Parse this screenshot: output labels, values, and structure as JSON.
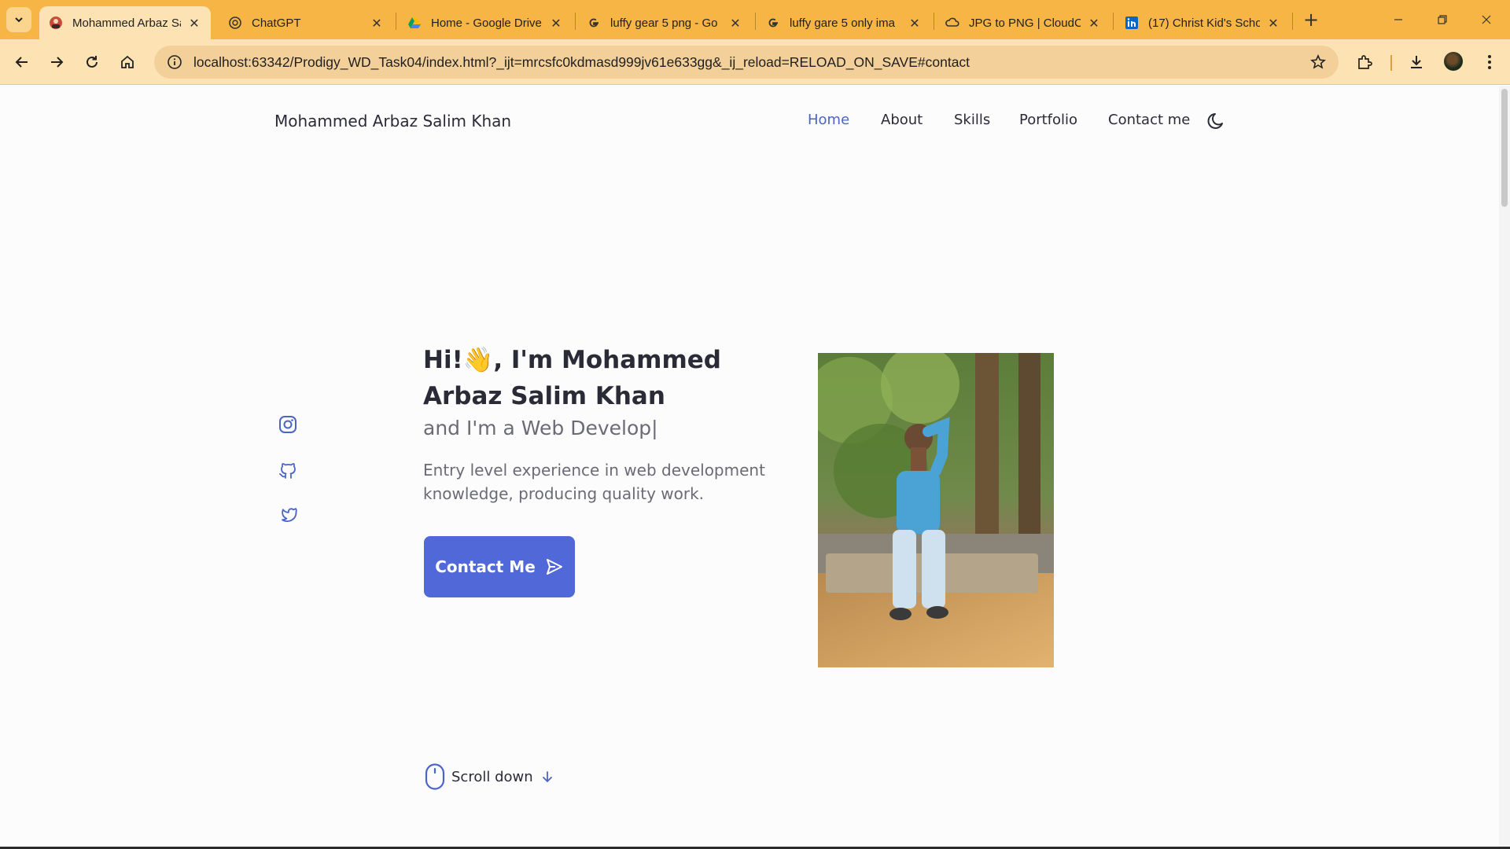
{
  "browser": {
    "tabs": [
      {
        "title": "Mohammed Arbaz Sa",
        "icon": "avatar-favicon",
        "active": true
      },
      {
        "title": "ChatGPT",
        "icon": "chatgpt-icon"
      },
      {
        "title": "Home - Google Drive",
        "icon": "google-drive-icon"
      },
      {
        "title": "luffy gear 5 png - Go",
        "icon": "google-icon"
      },
      {
        "title": "luffy gare 5 only ima",
        "icon": "google-icon"
      },
      {
        "title": "JPG to PNG | CloudC",
        "icon": "cloudconvert-icon"
      },
      {
        "title": "(17) Christ Kid's Scho",
        "icon": "linkedin-icon"
      }
    ],
    "url": "localhost:63342/Prodigy_WD_Task04/index.html?_ijt=mrcsfc0kdmasd999jv61e633gg&_ij_reload=RELOAD_ON_SAVE#contact",
    "theme_color": "#f7b546"
  },
  "site": {
    "brand": "Mohammed Arbaz Salim Khan",
    "nav": [
      "Home",
      "About",
      "Skills",
      "Portfolio",
      "Contact me"
    ],
    "active_nav": "Home",
    "accent_color": "#5168d9"
  },
  "hero": {
    "greeting_start": "Hi!",
    "emoji": "👋",
    "greeting_end": ", I'm Mohammed Arbaz Salim Khan",
    "subtitle": "and I'm a Web Develop|",
    "description": "Entry level experience in web development knowledge, producing quality work.",
    "cta_label": "Contact Me",
    "scroll_label": "Scroll down"
  },
  "social": [
    "instagram-icon",
    "github-icon",
    "twitter-icon"
  ]
}
